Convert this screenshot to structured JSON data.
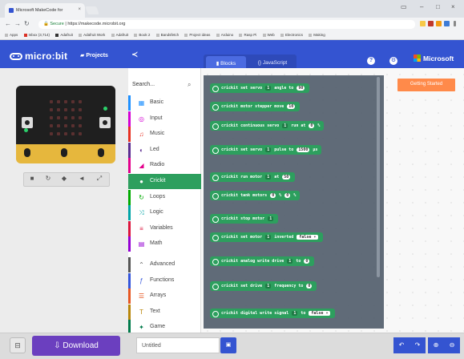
{
  "browser": {
    "tab_title": "Microsoft MakeCode for",
    "url_secure": "Secure",
    "url": "https://makecode.microbit.org",
    "bookmarks": [
      "Apps",
      "Inbox (3,714)",
      "Adafruit",
      "Adafruit Work",
      "Adafruit",
      "Book 2",
      "Bandsfetch",
      "Project ideas",
      "Arduino",
      "Rasp Pi",
      "Web",
      "Electronics",
      "Making"
    ]
  },
  "header": {
    "logo_text": "micro:bit",
    "projects_label": "Projects",
    "blocks_label": "Blocks",
    "javascript_label": "{} JavaScript",
    "brand": "Microsoft"
  },
  "toolbox": {
    "search_placeholder": "Search...",
    "categories": [
      {
        "label": "Basic",
        "icon": "grid-icon",
        "color": "#1e90ff"
      },
      {
        "label": "Input",
        "icon": "target-icon",
        "color": "#d400d4"
      },
      {
        "label": "Music",
        "icon": "headphones-icon",
        "color": "#e63022"
      },
      {
        "label": "Led",
        "icon": "toggle-icon",
        "color": "#5c2d91"
      },
      {
        "label": "Radio",
        "icon": "signal-icon",
        "color": "#e3008c"
      },
      {
        "label": "Crickit",
        "icon": "circle-icon",
        "color": "#2d9f5e"
      },
      {
        "label": "Loops",
        "icon": "loop-icon",
        "color": "#00aa00"
      },
      {
        "label": "Logic",
        "icon": "shuffle-icon",
        "color": "#00a4a6"
      },
      {
        "label": "Variables",
        "icon": "list-icon",
        "color": "#dc143c"
      },
      {
        "label": "Math",
        "icon": "calculator-icon",
        "color": "#9400d3"
      },
      {
        "label": "Advanced",
        "icon": "chevron-up-icon",
        "color": "#555555"
      },
      {
        "label": "Functions",
        "icon": "function-icon",
        "color": "#3455db"
      },
      {
        "label": "Arrays",
        "icon": "array-icon",
        "color": "#e65722"
      },
      {
        "label": "Text",
        "icon": "text-icon",
        "color": "#b8860b"
      },
      {
        "label": "Game",
        "icon": "gamepad-icon",
        "color": "#007a4b"
      }
    ]
  },
  "flyout": {
    "blocks": [
      {
        "pre": "crickit set servo",
        "p1": "1",
        "mid": "angle to",
        "v1": "90",
        "post": ""
      },
      {
        "pre": "crickit motor stepper move",
        "v1": "10",
        "post": ""
      },
      {
        "pre": "crickit continuous servo",
        "p1": "1",
        "mid": "run at",
        "v1": "0",
        "post": "%"
      },
      {
        "pre": "crickit set servo",
        "p1": "1",
        "mid": "pulse to",
        "v1": "1500",
        "post": "μs"
      },
      {
        "pre": "crickit run motor",
        "p1": "1",
        "mid": "at",
        "v1": "50",
        "post": ""
      },
      {
        "pre": "crickit tank motors",
        "v1": "0",
        "mid": "%",
        "v2": "0",
        "post": "%"
      },
      {
        "pre": "crickit stop motor",
        "p1": "1",
        "post": ""
      },
      {
        "pre": "crickit set motor",
        "p1": "1",
        "mid": "inverted",
        "d1": "false ▾",
        "post": ""
      },
      {
        "pre": "crickit analog write drive",
        "p1": "1",
        "mid": "to",
        "v1": "0",
        "post": ""
      },
      {
        "pre": "crickit set drive",
        "p1": "1",
        "mid": "frequency to",
        "v1": "0",
        "post": ""
      },
      {
        "pre": "crickit digital write signal",
        "p1": "1",
        "mid": "to",
        "d1": "false ▾",
        "post": ""
      }
    ]
  },
  "workspace": {
    "getting_started": "Getting Started"
  },
  "footer": {
    "download_label": "Download",
    "project_name": "Untitled"
  }
}
